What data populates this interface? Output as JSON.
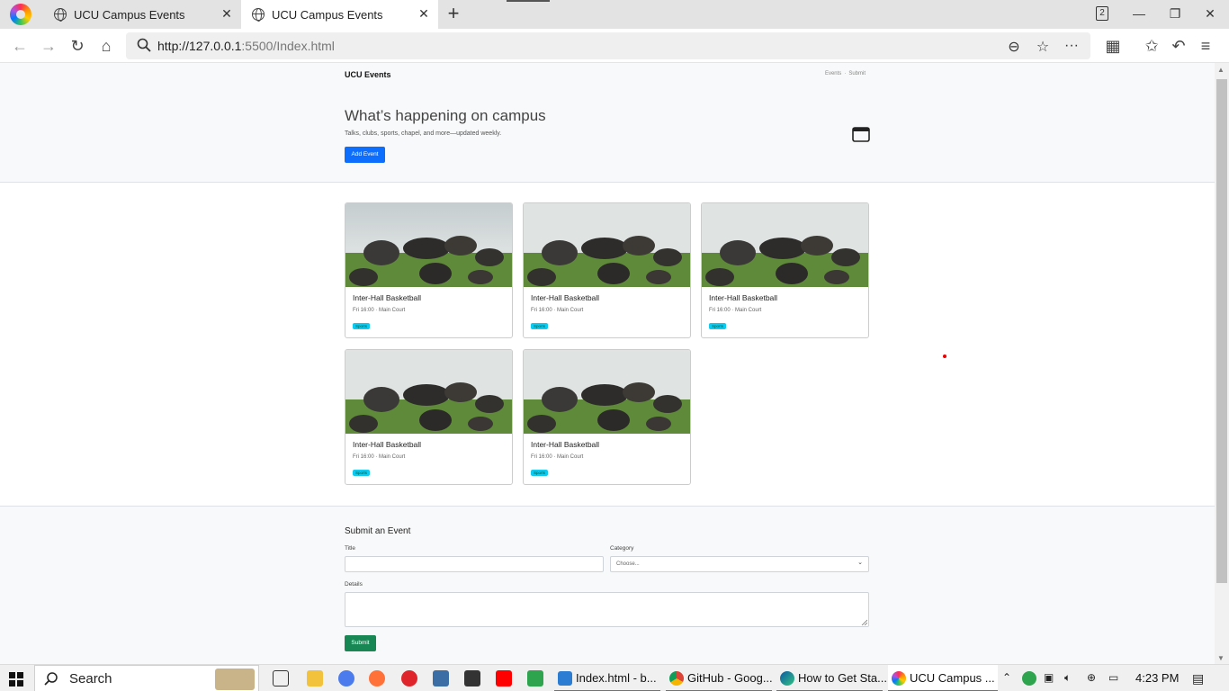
{
  "browser": {
    "tabs": [
      {
        "title": "UCU Campus Events",
        "close": "✕"
      },
      {
        "title": "UCU Campus Events",
        "close": "✕"
      }
    ],
    "new_tab": "+",
    "tab_count": "2",
    "window": {
      "minimize": "—",
      "maximize": "❐",
      "close": "✕"
    },
    "nav": {
      "back": "←",
      "forward": "→",
      "reload": "↻",
      "home": "⌂"
    },
    "url_host": "http://127.0.0.1",
    "url_rest": ":5500/Index.html",
    "tools": {
      "zoom": "⊖",
      "bookmark": "☆",
      "more": "···",
      "extensions": "▦",
      "favorites": "✩",
      "undo": "↶",
      "menu": "≡"
    }
  },
  "site": {
    "brand": "UCU Events",
    "nav": [
      "Events",
      "·",
      "Submit"
    ],
    "hero_title": "What’s happening on campus",
    "hero_sub": "Talks, clubs, sports, chapel, and more—updated weekly.",
    "add_event_label": "Add Event"
  },
  "events": [
    {
      "title": "Inter-Hall Basketball",
      "meta": "Fri 16:00 · Main Court",
      "badge": "Sports"
    },
    {
      "title": "Inter-Hall Basketball",
      "meta": "Fri 16:00 · Main Court",
      "badge": "Sports"
    },
    {
      "title": "Inter-Hall Basketball",
      "meta": "Fri 16:00 · Main Court",
      "badge": "Sports"
    },
    {
      "title": "Inter-Hall Basketball",
      "meta": "Fri 16:00 · Main Court",
      "badge": "Sports"
    },
    {
      "title": "Inter-Hall Basketball",
      "meta": "Fri 16:00 · Main Court",
      "badge": "Sports"
    }
  ],
  "form": {
    "heading": "Submit an Event",
    "title_label": "Title",
    "title_value": "",
    "category_label": "Category",
    "category_selected": "Choose...",
    "details_label": "Details",
    "details_value": "",
    "submit_label": "Submit"
  },
  "taskbar": {
    "search_text": "Search",
    "apps": [
      {
        "label": "Index.html - b..."
      },
      {
        "label": "GitHub - Goog..."
      },
      {
        "label": "How to Get Sta..."
      },
      {
        "label": "UCU Campus ..."
      }
    ],
    "clock": "4:23 PM"
  },
  "colors": {
    "primary": "#0d6efd",
    "success": "#198754",
    "info": "#0dcaf0"
  }
}
